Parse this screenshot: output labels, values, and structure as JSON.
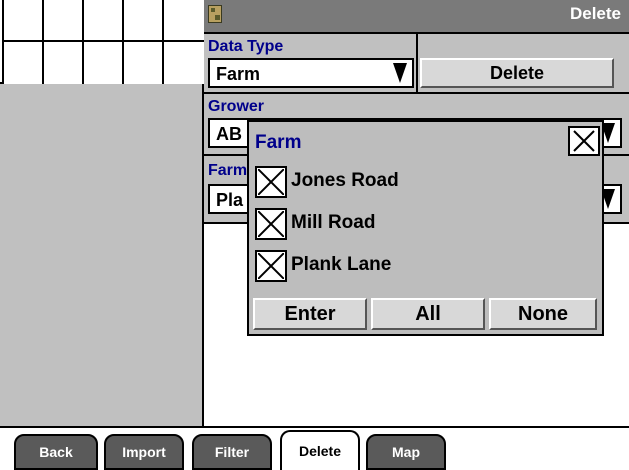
{
  "header": {
    "title": "Delete",
    "icon": "screen-icon"
  },
  "left_grid": {
    "rows": 2,
    "columns": 5
  },
  "data_type": {
    "label": "Data Type",
    "value": "Farm"
  },
  "delete_button": {
    "label": "Delete"
  },
  "grower": {
    "label": "Grower",
    "value": "AB"
  },
  "farm": {
    "label": "Farm",
    "value": "Pla"
  },
  "modal": {
    "title": "Farm",
    "close_icon": "close-icon",
    "items": [
      {
        "label": "Jones Road",
        "checked": true
      },
      {
        "label": "Mill Road",
        "checked": true
      },
      {
        "label": "Plank Lane",
        "checked": true
      }
    ],
    "buttons": {
      "enter": "Enter",
      "all": "All",
      "none": "None"
    }
  },
  "tabs": [
    {
      "label": "Back",
      "active": false
    },
    {
      "label": "Import",
      "active": false
    },
    {
      "label": "Filter",
      "active": false
    },
    {
      "label": "Delete",
      "active": true
    },
    {
      "label": "Map",
      "active": false
    }
  ],
  "colors": {
    "panel_gray": "#c0c0c0",
    "title_bar": "#7a7a7a",
    "label_blue": "#00008b",
    "tab_dark": "#5a5a5a"
  }
}
